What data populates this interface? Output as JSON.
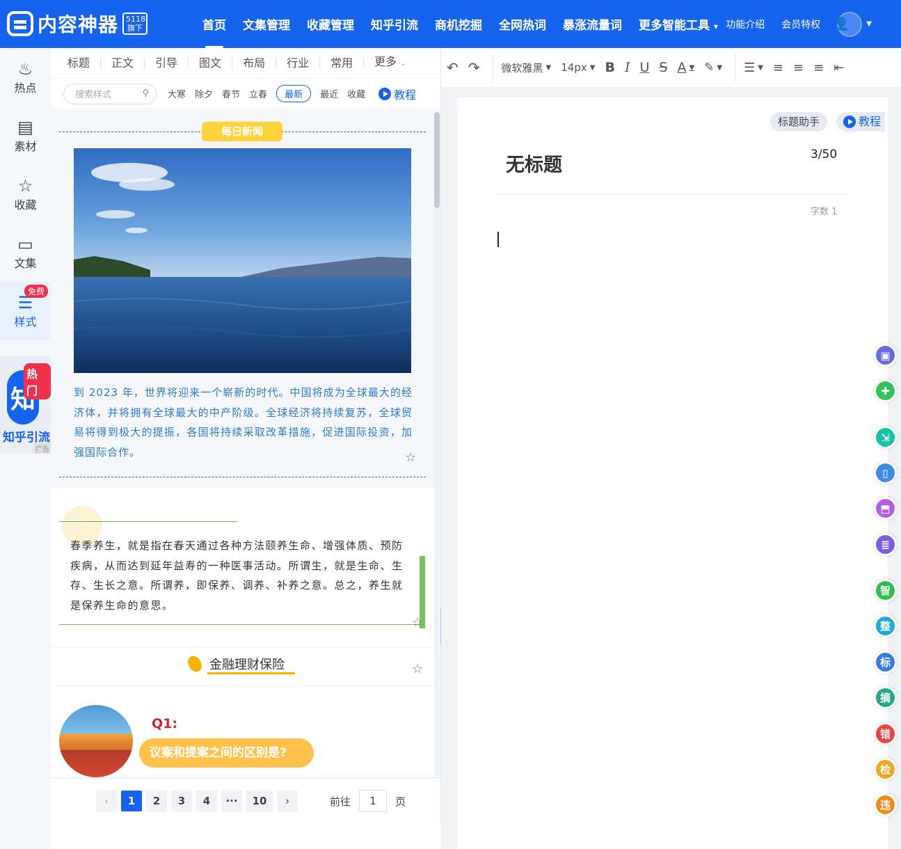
{
  "header": {
    "logo_text": "内容神器",
    "logo_badge": "5118 旗下",
    "nav": [
      "首页",
      "文集管理",
      "收藏管理",
      "知乎引流",
      "商机挖掘",
      "全网热词",
      "暴涨流量词",
      "更多智能工具"
    ],
    "active_nav": "首页",
    "feature_intro": "功能介绍",
    "member_perks": "会员特权"
  },
  "sidebar": {
    "items": [
      {
        "label": "热点",
        "icon": "flame-icon"
      },
      {
        "label": "素材",
        "icon": "inbox-icon"
      },
      {
        "label": "收藏",
        "icon": "star-edit-icon"
      },
      {
        "label": "文集",
        "icon": "document-icon"
      },
      {
        "label": "样式",
        "icon": "style-list-icon",
        "badge": "免费"
      }
    ],
    "ad": {
      "circle": "知",
      "hot": "热门",
      "text": "知乎引流",
      "tag": "广告"
    }
  },
  "style_panel": {
    "tabs": [
      "标题",
      "正文",
      "引导",
      "图文",
      "布局",
      "行业",
      "常用",
      "更多"
    ],
    "search_placeholder": "搜索样式",
    "keywords": [
      "大寒",
      "除夕",
      "春节",
      "立春",
      "最新",
      "最近",
      "收藏"
    ],
    "active_keyword": "最新",
    "tutorial": "教程",
    "card1": {
      "pill": "每日新闻",
      "text": "到 2023 年，世界将迎来一个崭新的时代。中国将成为全球最大的经济体，并将拥有全球最大的中产阶级。全球经济将持续复苏，全球贸易将得到极大的提振，各国将持续采取改革措施，促进国际投资，加强国际合作。"
    },
    "card2": {
      "text": "春季养生，就是指在春天通过各种方法颐养生命、增强体质、预防疾病，从而达到延年益寿的一种医事活动。所谓生，就是生命、生存、生长之意。所谓养，即保养、调养、补养之意。总之，养生就是保养生命的意思。"
    },
    "card3": {
      "title": "金融理财保险"
    },
    "card4": {
      "q": "Q1:",
      "question": "议案和提案之间的区别是?"
    },
    "pager": {
      "prev": "‹",
      "pages": [
        "1",
        "2",
        "3",
        "4",
        "···",
        "10"
      ],
      "next": "›",
      "goto_label": "前往",
      "goto_value": "1",
      "page_label": "页"
    }
  },
  "toolbar": {
    "font_family": "微软雅黑",
    "font_size": "14px"
  },
  "editor": {
    "title_helper": "标题助手",
    "tutorial": "教程",
    "title": "无标题",
    "title_count": "3/50",
    "word_count": "字数 1"
  },
  "right_rail": [
    {
      "name": "save-doc-fab",
      "label": "",
      "color": "#6b6cd8"
    },
    {
      "name": "add-doc-fab",
      "label": "",
      "color": "#33c35a"
    },
    {
      "name": "import-doc-fab",
      "label": "",
      "color": "#19c1a8"
    },
    {
      "name": "mobile-preview-fab",
      "label": "",
      "color": "#3f8be8"
    },
    {
      "name": "image-download-fab",
      "label": "",
      "color": "#b35ee0"
    },
    {
      "name": "list-doc-fab",
      "label": "",
      "color": "#7c5ce0"
    },
    {
      "name": "smart-fab",
      "label": "智",
      "color": "#2fbf4f"
    },
    {
      "name": "organize-fab",
      "label": "整",
      "color": "#20a9d6"
    },
    {
      "name": "title-fab",
      "label": "标",
      "color": "#3a7ce6"
    },
    {
      "name": "abstract-fab",
      "label": "摘",
      "color": "#21a98a"
    },
    {
      "name": "typo-fab",
      "label": "错",
      "color": "#ef4141"
    },
    {
      "name": "check-fab",
      "label": "检",
      "color": "#f2a623"
    },
    {
      "name": "violation-fab",
      "label": "违",
      "color": "#ef8a1d"
    }
  ]
}
